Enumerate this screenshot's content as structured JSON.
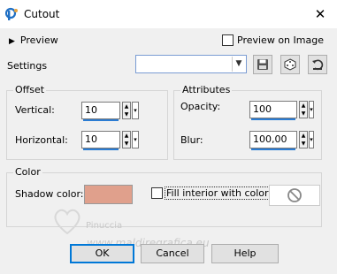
{
  "window": {
    "title": "Cutout",
    "close_glyph": "✕",
    "icon": "paintshop-pro-icon"
  },
  "preview": {
    "label": "Preview",
    "on_image_label": "Preview on Image",
    "on_image_checked": false
  },
  "settings": {
    "label": "Settings",
    "selected": ""
  },
  "offset": {
    "title": "Offset",
    "vertical_label": "Vertical:",
    "vertical_value": "10",
    "horizontal_label": "Horizontal:",
    "horizontal_value": "10"
  },
  "attributes": {
    "title": "Attributes",
    "opacity_label": "Opacity:",
    "opacity_value": "100",
    "blur_label": "Blur:",
    "blur_value": "100,00"
  },
  "color": {
    "title": "Color",
    "shadow_label": "Shadow color:",
    "shadow_color": "#e0a08c",
    "fill_label": "Fill interior with color:",
    "fill_checked": false
  },
  "watermark": {
    "name": "Pinuccia",
    "site": "www.maldiregrafica.eu"
  },
  "buttons": {
    "ok": "OK",
    "cancel": "Cancel",
    "help": "Help"
  }
}
